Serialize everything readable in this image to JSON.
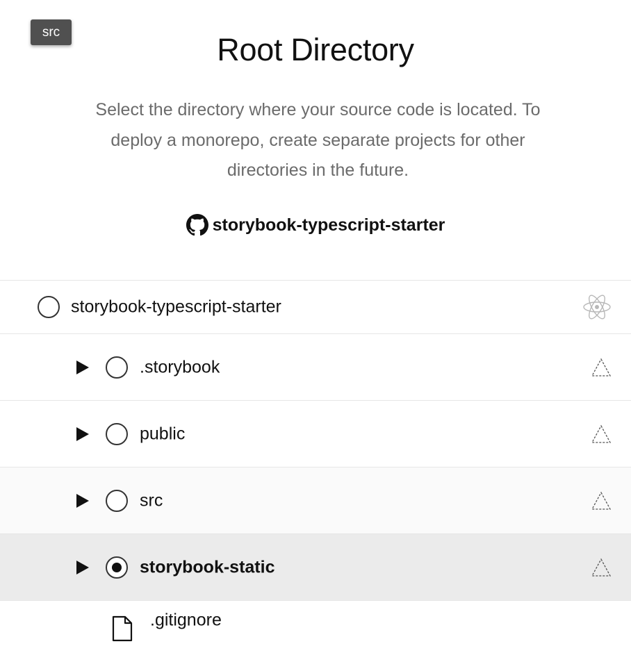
{
  "tooltip": {
    "text": "src"
  },
  "header": {
    "title": "Root Directory",
    "description_lines": [
      "Select the directory where your source code is located. To",
      "deploy a monorepo, create separate projects for other",
      "directories in the future."
    ]
  },
  "repo": {
    "name": "storybook-typescript-starter",
    "icon": "github-icon"
  },
  "tree": {
    "root": {
      "label": "storybook-typescript-starter",
      "icon": "react-icon",
      "selected": false
    },
    "children": [
      {
        "label": ".storybook",
        "selected": false,
        "icon": "unknown-framework-icon"
      },
      {
        "label": "public",
        "selected": false,
        "icon": "unknown-framework-icon"
      },
      {
        "label": "src",
        "selected": false,
        "icon": "unknown-framework-icon"
      },
      {
        "label": "storybook-static",
        "selected": true,
        "icon": "unknown-framework-icon"
      }
    ],
    "files": [
      {
        "label": ".gitignore",
        "icon": "file-icon"
      }
    ]
  },
  "colors": {
    "selected_row_bg": "#ebebeb",
    "hover_row_bg": "#fafafa",
    "description_text": "#6b6b6b",
    "tooltip_bg": "#505050"
  }
}
